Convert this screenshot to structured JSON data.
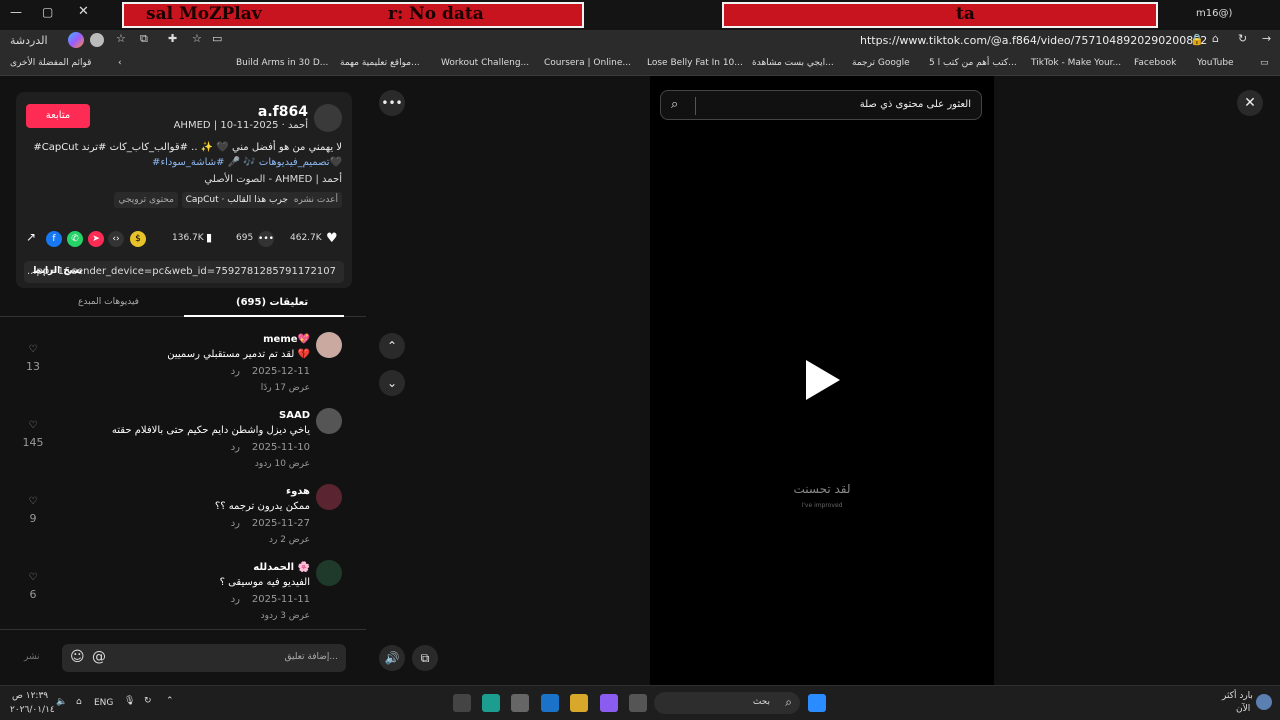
{
  "banner": {
    "left_text": "sal   MoZPlav",
    "mid_text": "r: No data",
    "right_text": "ta",
    "handle": "m16@)"
  },
  "browser": {
    "url": "https://www.tiktok.com/@a.f864/video/7571048920290200852",
    "chat_label": "الدردشة",
    "bookmarks_folder": "قوائم المفضلة الأخرى",
    "bookmarks": [
      "Build Arms in 30 D...",
      "مواقع تعليمية مهمة...",
      "Workout Challeng...",
      "Coursera | Online...",
      "Lose Belly Fat In 10...",
      "ايجي بست مشاهدة...",
      "ترجمة Google",
      "5 كتب أهم من كتب ا...",
      "TikTok - Make Your...",
      "Facebook",
      "YouTube"
    ]
  },
  "post": {
    "follow_label": "متابعة",
    "username": "a.f864",
    "display_meta": "AHMED | أحمد · 2025-11-10",
    "caption_line1": "#CapCut لا يهمني من هو أفضل مني 🖤 ✨ .. #قوالب_كاب_كات #ترند",
    "caption_line2": "#تصميم_فيديوهات 🎶 🎤 #شاشة_سوداء🖤",
    "music": "الصوت الأصلي - AHMED | أحمد",
    "reposted": "أعدت نشره",
    "capcut_label": "CapCut · جرب هذا القالب",
    "ai_label": "محتوى ترويجي",
    "likes": "462.7K",
    "comments": "695",
    "saves": "136.7K",
    "link_value": "...pp=1&sender_device=pc&web_id=7592781285791172107",
    "copy_link_label": "نسخ الرابط",
    "tab_comments": "تعليقات (695)",
    "tab_creator": "فيديوهات المبدع"
  },
  "comments": [
    {
      "name": "meme💖",
      "text": "لقد تم تدمير مستقبلي رسميين 💔",
      "date": "2025-12-11",
      "reply": "رد",
      "more": "عرض 17 ردًا",
      "likes": "13"
    },
    {
      "name": "SAAD",
      "text": "ياخي ديزل واشطن دايم حكيم حتى بالافلام حقته",
      "date": "2025-11-10",
      "reply": "رد",
      "more": "عرض 10 ردود",
      "likes": "145"
    },
    {
      "name": "هدوء",
      "text": "ممكن يدرون ترجمه ؟؟",
      "date": "2025-11-27",
      "reply": "رد",
      "more": "عرض 2 رد",
      "likes": "9"
    },
    {
      "name": "الحمدلله 🌸",
      "text": "الفيديو فيه موسيقى ؟",
      "date": "2025-11-11",
      "reply": "رد",
      "more": "عرض 3 ردود",
      "likes": "6"
    }
  ],
  "comment_box": {
    "placeholder": "إضافة تعليق...",
    "post_label": "نشر"
  },
  "video": {
    "search_placeholder": "العثور على محتوى ذي صلة",
    "overlay_main": "لقد تحسنت",
    "overlay_sub": "I've improved"
  },
  "taskbar": {
    "search_label": "بحث",
    "lang": "ENG",
    "time": "١٢:٣٩ ص",
    "date": "٢٠٢٦/٠١/١٤",
    "weather": "بارد أكثر",
    "weather_sub": "الآن"
  },
  "colors": {
    "accent": "#fe2c55",
    "banner_red": "#c8141e"
  }
}
